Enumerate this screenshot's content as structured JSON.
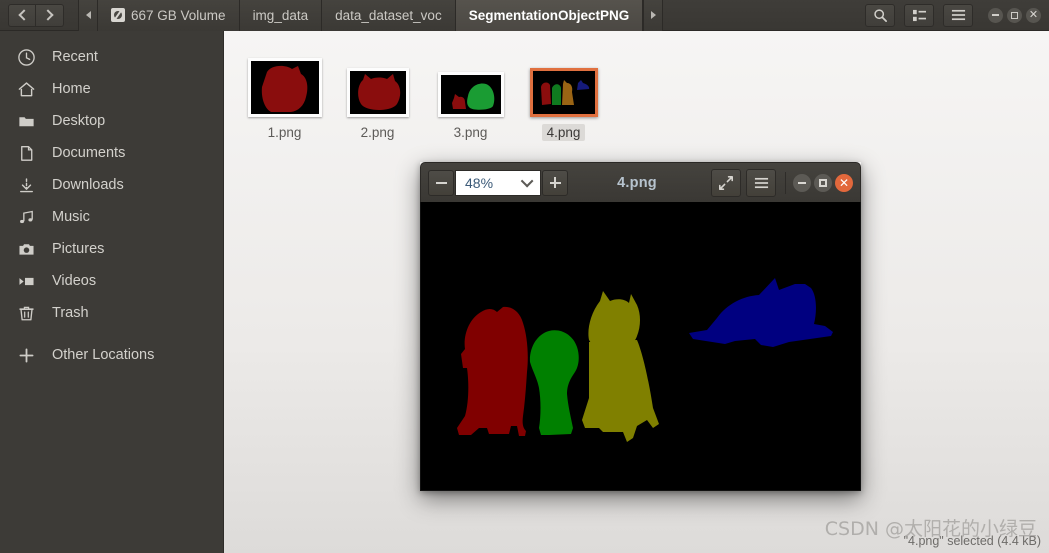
{
  "window": {
    "header": {
      "nav": {
        "back_label": "Back",
        "forward_label": "Forward"
      },
      "breadcrumbs": [
        {
          "label": "667 GB Volume",
          "icon": "drive-icon",
          "active": false
        },
        {
          "label": "img_data",
          "icon": null,
          "active": false
        },
        {
          "label": "data_dataset_voc",
          "icon": null,
          "active": false
        },
        {
          "label": "SegmentationObjectPNG",
          "icon": null,
          "active": true
        }
      ],
      "actions": [
        {
          "name": "search-icon",
          "label": "Search"
        },
        {
          "name": "view-options-icon",
          "label": "View options"
        },
        {
          "name": "hamburger-menu-icon",
          "label": "Menu"
        }
      ],
      "window_controls": [
        {
          "name": "minimize-button",
          "label": "Minimize"
        },
        {
          "name": "maximize-button",
          "label": "Maximize"
        },
        {
          "name": "close-button",
          "label": "Close"
        }
      ]
    }
  },
  "sidebar": {
    "items": [
      {
        "label": "Recent",
        "icon": "clock-icon"
      },
      {
        "label": "Home",
        "icon": "home-icon"
      },
      {
        "label": "Desktop",
        "icon": "folder-icon"
      },
      {
        "label": "Documents",
        "icon": "document-icon"
      },
      {
        "label": "Downloads",
        "icon": "download-icon"
      },
      {
        "label": "Music",
        "icon": "music-note-icon"
      },
      {
        "label": "Pictures",
        "icon": "camera-icon"
      },
      {
        "label": "Videos",
        "icon": "video-icon"
      },
      {
        "label": "Trash",
        "icon": "trash-icon"
      },
      {
        "label": "Other Locations",
        "icon": "plus-icon"
      }
    ]
  },
  "files": [
    {
      "name": "1.png",
      "selected": false,
      "thumb_w": 74,
      "thumb_h": 59,
      "shapes": "one-large-red-dog"
    },
    {
      "name": "2.png",
      "selected": false,
      "thumb_w": 62,
      "thumb_h": 49,
      "shapes": "one-red-cat"
    },
    {
      "name": "3.png",
      "selected": false,
      "thumb_w": 66,
      "thumb_h": 45,
      "shapes": "green-dog-and-red-cat"
    },
    {
      "name": "4.png",
      "selected": true,
      "thumb_w": 68,
      "thumb_h": 49,
      "shapes": "red-green-olive-blue-animals"
    }
  ],
  "viewer": {
    "title": "4.png",
    "zoom_level": "48%",
    "zoom_out_label": "Zoom out",
    "zoom_in_label": "Zoom in",
    "fullscreen_label": "Fullscreen",
    "menu_label": "Menu",
    "window_controls": [
      {
        "name": "viewer-minimize-button",
        "label": "Minimize"
      },
      {
        "name": "viewer-maximize-button",
        "label": "Maximize"
      },
      {
        "name": "viewer-close-button",
        "label": "Close"
      }
    ],
    "image": {
      "background": "#000000",
      "objects": [
        {
          "label": "red-dog",
          "color": "#800000"
        },
        {
          "label": "green-dog",
          "color": "#008000"
        },
        {
          "label": "olive-cat",
          "color": "#808000"
        },
        {
          "label": "blue-cat",
          "color": "#000080"
        }
      ]
    }
  },
  "status": {
    "text": "\"4.png\" selected (4.4 kB)"
  },
  "watermark": {
    "text": "CSDN @太阳花的小绿豆"
  },
  "colors": {
    "accent_selection": "#e0703f",
    "header_bg": "#3d3b37",
    "sidebar_bg": "#3d3b37",
    "content_bg": "#f2f1f0",
    "voc_class_1": "#800000",
    "voc_class_2": "#008000",
    "voc_class_3": "#808000",
    "voc_class_4": "#000080"
  }
}
